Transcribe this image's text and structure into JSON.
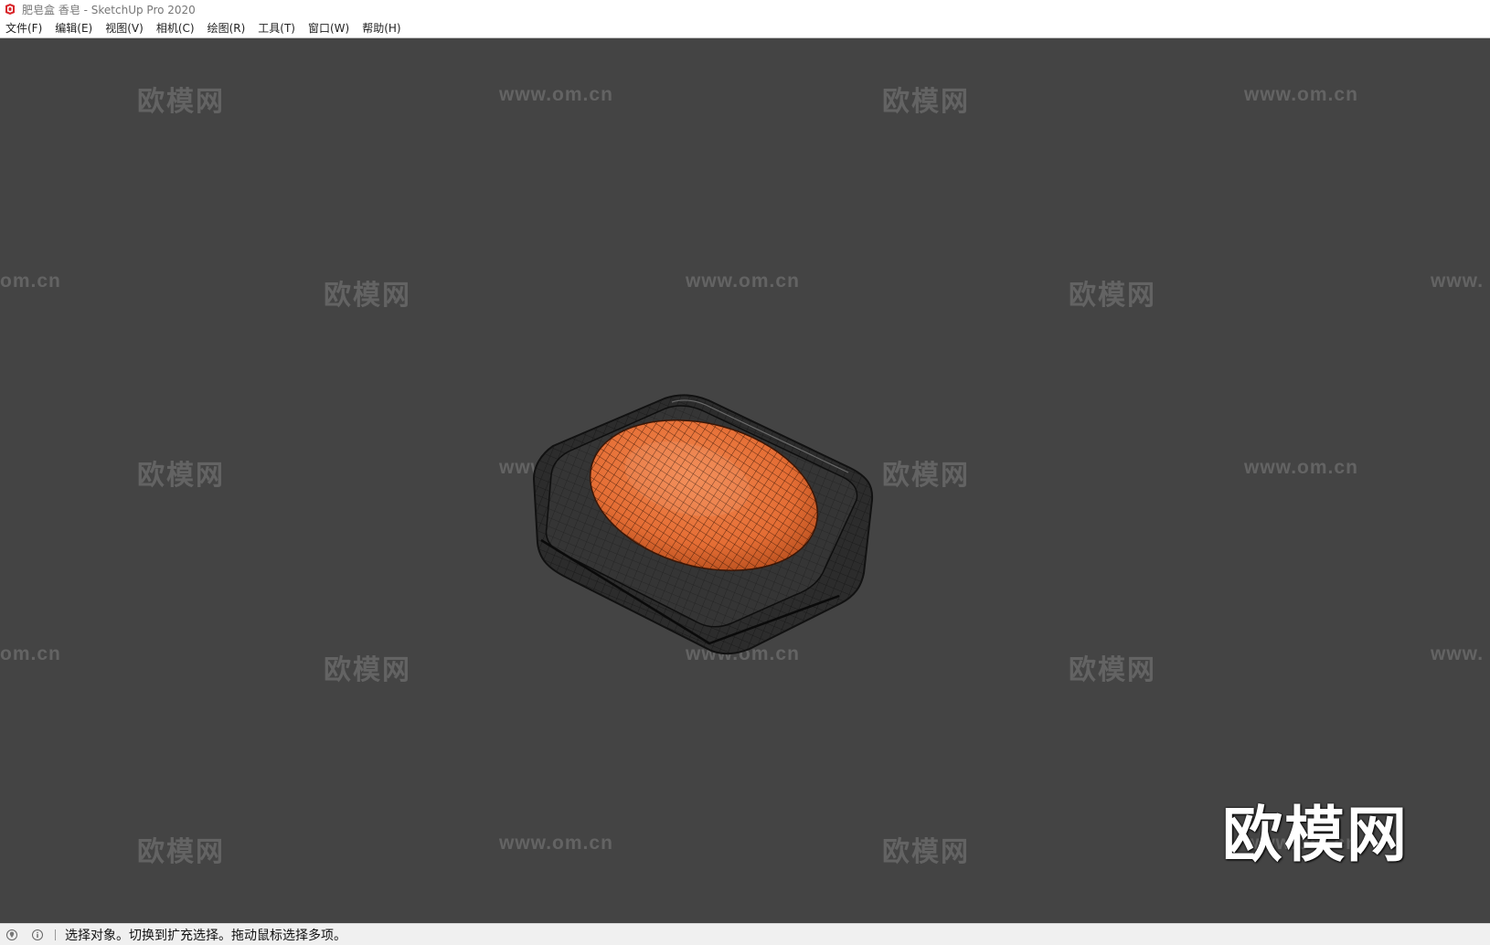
{
  "window": {
    "title": "肥皂盒 香皂 - SketchUp Pro 2020"
  },
  "menu": {
    "items": [
      "文件(F)",
      "编辑(E)",
      "视图(V)",
      "相机(C)",
      "绘图(R)",
      "工具(T)",
      "窗口(W)",
      "帮助(H)"
    ]
  },
  "watermarks": {
    "brand": "欧模网",
    "url": "www.om.cn",
    "url_left_partial": "om.cn",
    "url_right_partial": "www."
  },
  "logo": {
    "text": "欧模网"
  },
  "status": {
    "text": "选择对象。切换到扩充选择。拖动鼠标选择多项。",
    "icons": [
      "geolocation-icon",
      "info-icon"
    ]
  },
  "colors": {
    "viewport_bg": "#444444",
    "soap": "#e9773f",
    "dish": "#2b2b2b"
  }
}
